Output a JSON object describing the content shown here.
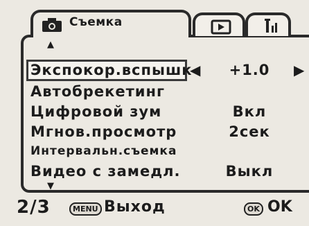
{
  "tabs": {
    "shooting_label": "Съемка",
    "active": "shooting",
    "icons": [
      "camera-icon",
      "playback-icon",
      "setup-icon"
    ]
  },
  "menu": {
    "items": [
      {
        "label": "Экспокор.вспышк",
        "value": "+1.0",
        "selected": true
      },
      {
        "label": "Автобрекетинг",
        "value": ""
      },
      {
        "label": "Цифровой зум",
        "value": "Вкл"
      },
      {
        "label": "Мгнов.просмотр",
        "value": "2сек"
      },
      {
        "label": "Интервальн.съемка",
        "value": ""
      },
      {
        "label": "Видео с замедл.",
        "value": "Выкл"
      }
    ]
  },
  "footer": {
    "page": "2/3",
    "menu_key": "MENU",
    "exit_label": "Выход",
    "ok_key": "OK",
    "ok_label": "OK"
  }
}
